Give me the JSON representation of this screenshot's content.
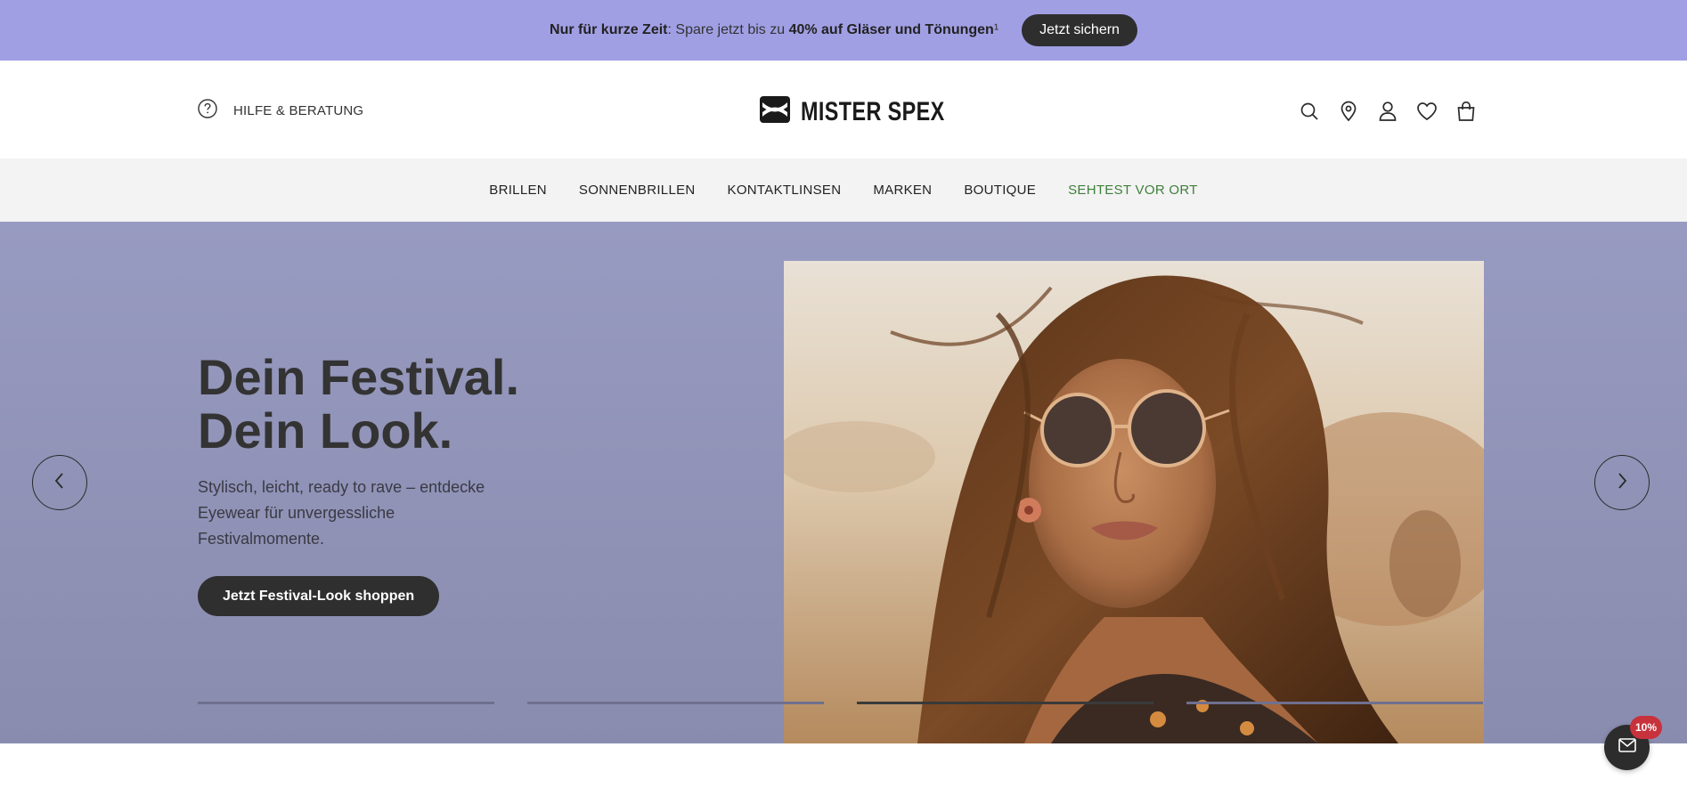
{
  "promo": {
    "text_bold_1": "Nur für kurze Zeit",
    "text_mid": ": Spare jetzt bis zu ",
    "text_bold_2": "40% auf Gläser und Tönungen",
    "text_sup": "¹",
    "button_label": "Jetzt sichern",
    "bg_color": "#a19fe4"
  },
  "header": {
    "help_icon": "question-circle-icon",
    "help_label": "HILFE & BERATUNG",
    "logo_text": "MISTER SPEX",
    "icons": [
      "search-icon",
      "location-pin-icon",
      "user-icon",
      "heart-icon",
      "shopping-bag-icon"
    ]
  },
  "nav": {
    "items": [
      {
        "label": "BRILLEN"
      },
      {
        "label": "SONNENBRILLEN"
      },
      {
        "label": "KONTAKTLINSEN"
      },
      {
        "label": "MARKEN"
      },
      {
        "label": "BOUTIQUE"
      },
      {
        "label": "SEHTEST VOR ORT",
        "color": "#3f7f3a"
      }
    ]
  },
  "hero": {
    "title_line_1": "Dein Festival.",
    "title_line_2": "Dein Look.",
    "subtitle": "Stylisch, leicht, ready to rave – entdecke Eyewear für unvergessliche Festivalmomente.",
    "cta_label": "Jetzt Festival-Look shoppen",
    "prev_icon": "chevron-left-icon",
    "next_icon": "chevron-right-icon",
    "bg_color": "#989bc1",
    "slides_total": 4,
    "active_slide": 3
  },
  "newsletter": {
    "icon": "envelope-icon",
    "badge": "10%"
  }
}
